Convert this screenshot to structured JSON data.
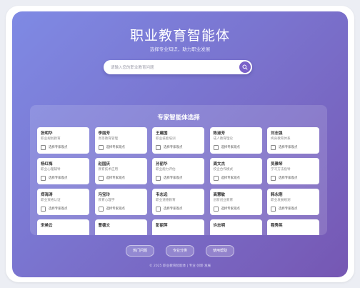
{
  "header": {
    "title": "职业教育智能体",
    "subtitle": "选择专业知识，助力职业发展"
  },
  "search": {
    "placeholder": "请输入您的职业教育问题"
  },
  "experts": {
    "section_title": "专家智能体选择",
    "select_label": "选择专家观点",
    "cards": [
      {
        "name": "张明华",
        "desc": "职业规划教育"
      },
      {
        "name": "李丽芳",
        "desc": "高等教育管理"
      },
      {
        "name": "王建国",
        "desc": "职业技能培训"
      },
      {
        "name": "陈淑芳",
        "desc": "成人教育理论"
      },
      {
        "name": "刘志强",
        "desc": "终身教育体系"
      },
      {
        "name": "杨红梅",
        "desc": "职业心理辅导"
      },
      {
        "name": "赵国庆",
        "desc": "教育技术应用"
      },
      {
        "name": "孙丽华",
        "desc": "职业能力评估"
      },
      {
        "name": "周文杰",
        "desc": "校企合作模式"
      },
      {
        "name": "吴雅琴",
        "desc": "学习方法指导"
      },
      {
        "name": "郑海涛",
        "desc": "职业资格认证"
      },
      {
        "name": "冯宝玲",
        "desc": "教育心理学"
      },
      {
        "name": "韦志远",
        "desc": "职业道德教育"
      },
      {
        "name": "高慧敏",
        "desc": "创新创业教育"
      },
      {
        "name": "韩永刚",
        "desc": "职业发展规划"
      },
      {
        "name": "宋美云",
        "desc": ""
      },
      {
        "name": "曹德文",
        "desc": ""
      },
      {
        "name": "彭丽萍",
        "desc": ""
      },
      {
        "name": "许志明",
        "desc": ""
      },
      {
        "name": "程秀英",
        "desc": ""
      }
    ]
  },
  "quick_buttons": [
    "热门问题",
    "专业分类",
    "使用帮助"
  ],
  "footer": {
    "text": "© 2025 职业教育智能体 | 专业·创新·发展"
  }
}
